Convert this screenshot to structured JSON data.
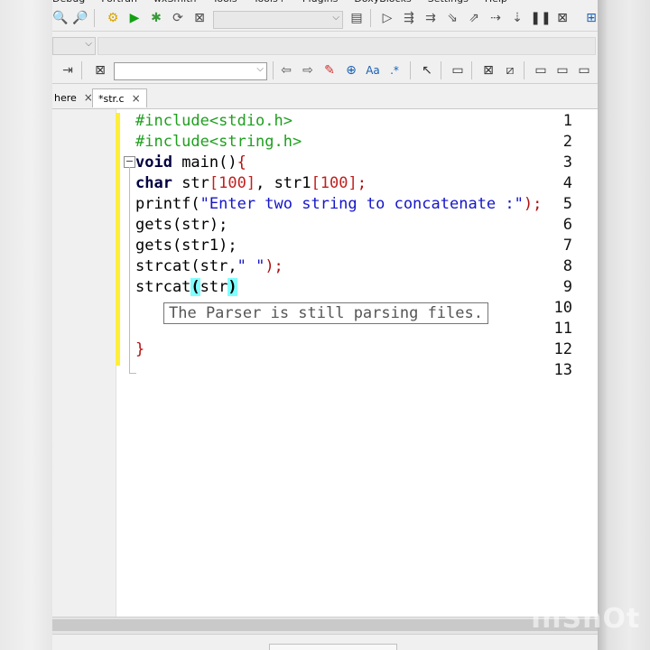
{
  "menubar": {
    "items": [
      "Debug",
      "Fortran",
      "wxSmith",
      "Tools",
      "Tools+",
      "Plugins",
      "DoxyBlocks",
      "Settings",
      "Help"
    ]
  },
  "tabs": [
    {
      "label": "here",
      "close": "×",
      "active": false
    },
    {
      "label": "*str.c",
      "close": "×",
      "active": true
    }
  ],
  "line_numbers": [
    "1",
    "2",
    "3",
    "4",
    "5",
    "6",
    "7",
    "8",
    "9",
    "10",
    "11",
    "12",
    "13"
  ],
  "code": {
    "l1": "#include<stdio.h>",
    "l2": "#include<string.h>",
    "l3_kw": "void",
    "l3_rest": " main()",
    "l3_brace": "{",
    "l4_kw": "char",
    "l4_a": " str",
    "l4_b": "[100]",
    "l4_c": ", str1",
    "l4_d": "[100]",
    "l4_e": ";",
    "l5_a": "printf(",
    "l5_str": "\"Enter two string to concatenate :\"",
    "l5_b": ");",
    "l6": "gets(str);",
    "l7": "gets(str1);",
    "l8_a": "strcat(str,",
    "l8_str": "\" \"",
    "l8_b": ");",
    "l9_a": "strcat",
    "l9_paren_open": "(",
    "l9_mid": "str",
    "l9_paren_close": ")",
    "l12_brace": "}"
  },
  "calltip": "The Parser is still parsing files.",
  "watermark": "InShOt",
  "colors": {
    "preprocessor": "#1f9f1f",
    "string": "#1515c8",
    "number": "#c02020",
    "changebar": "#ffee3a",
    "brace_match": "#7fffff"
  }
}
